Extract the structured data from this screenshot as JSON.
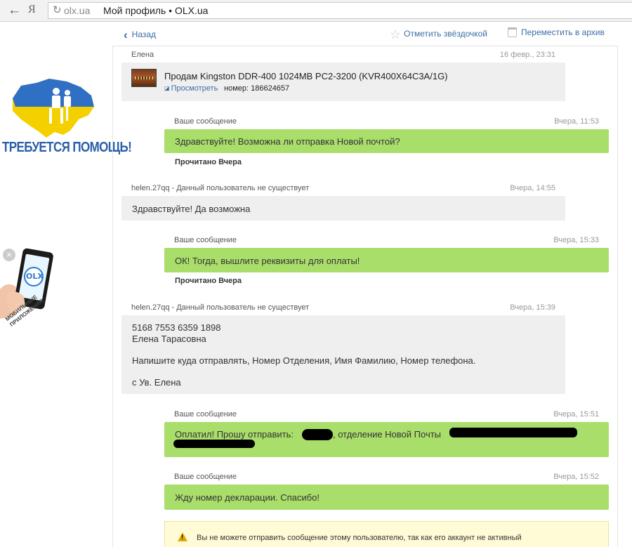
{
  "browser": {
    "back": "←",
    "ya": "Я",
    "url_domain": "olx.ua",
    "page_title": "Мой профиль • OLX.ua"
  },
  "ads": {
    "help_text": "ТРЕБУЕТСЯ ПОМОЩЬ!",
    "olx_logo": "OLX",
    "mobile_text": "МОБИЛЬНЫЕ ПРИЛОЖЕНИЯ",
    "close": "×"
  },
  "toolbar": {
    "back_label": "Назад",
    "star_label": "Отметить звёздочкой",
    "archive_label": "Переместить в архив"
  },
  "messages": [
    {
      "sender": "Елена",
      "time": "16 февр., 23:31",
      "listing": {
        "title": "Продам Kingston DDR-400 1024MB PC2-3200 (KVR400X64C3A/1G)",
        "view_label": "Просмотреть",
        "number": "номер: 186624657"
      }
    },
    {
      "sender": "Ваше сообщение",
      "time": "Вчера, 11:53",
      "text": "Здравствуйте! Возможна ли отправка Новой почтой?",
      "read": "Прочитано Вчера"
    },
    {
      "sender": "helen.27qq - Данный пользователь не существует",
      "time": "Вчера, 14:55",
      "text": "Здравствуйте! Да возможна"
    },
    {
      "sender": "Ваше сообщение",
      "time": "Вчера, 15:33",
      "text": "ОК! Тогда, вышлите реквизиты для оплаты!",
      "read": "Прочитано Вчера"
    },
    {
      "sender": "helen.27qq - Данный пользователь не существует",
      "time": "Вчера, 15:39",
      "lines": [
        "5168 7553 6359 1898",
        "Елена Тарасовна",
        "Напишите куда отправлять, Номер Отделения, Имя Фамилию, Номер телефона.",
        "с Ув. Елена"
      ]
    },
    {
      "sender": "Ваше сообщение",
      "time": "Вчера, 15:51",
      "text_a": "Оплатил! Прошу отправить:",
      "text_b": ", отделение Новой Почты"
    },
    {
      "sender": "Ваше сообщение",
      "time": "Вчера, 15:52",
      "text": "Жду номер декларации. Спасибо!"
    }
  ],
  "warning": {
    "text": "Вы не можете отправить сообщение этому пользователю, так как его аккаунт не активный"
  },
  "colors": {
    "link": "#3a6ea5",
    "green_bubble": "#a9de6b",
    "gray_bubble": "#efefef"
  }
}
